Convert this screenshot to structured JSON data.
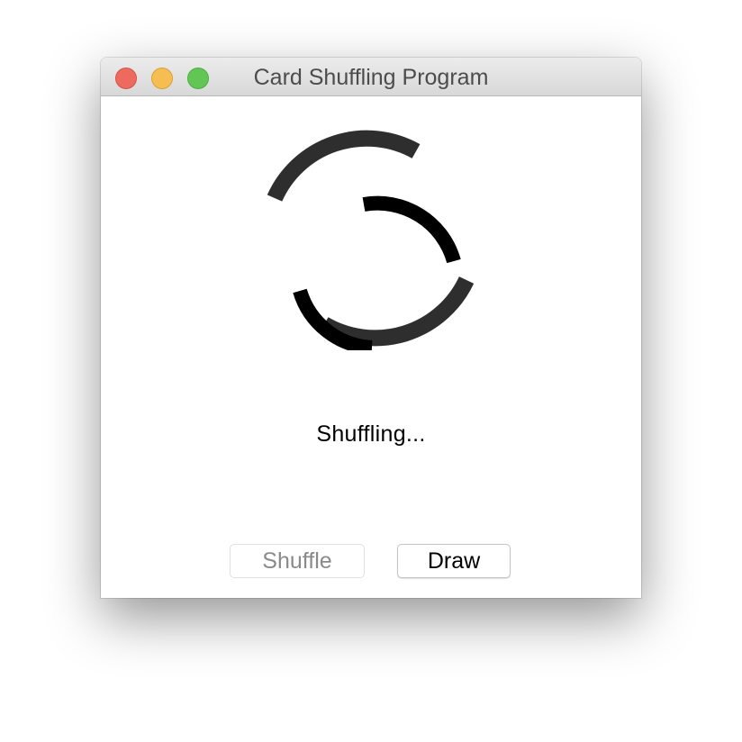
{
  "window": {
    "title": "Card Shuffling Program",
    "controls": [
      "close",
      "minimize",
      "zoom"
    ]
  },
  "spinner": {
    "icon": "loading-spinner-icon",
    "outer_color": "#2e2e2e",
    "inner_color": "#000000"
  },
  "status": {
    "text": "Shuffling..."
  },
  "buttons": {
    "shuffle": {
      "label": "Shuffle",
      "enabled": false
    },
    "draw": {
      "label": "Draw",
      "enabled": true
    }
  }
}
